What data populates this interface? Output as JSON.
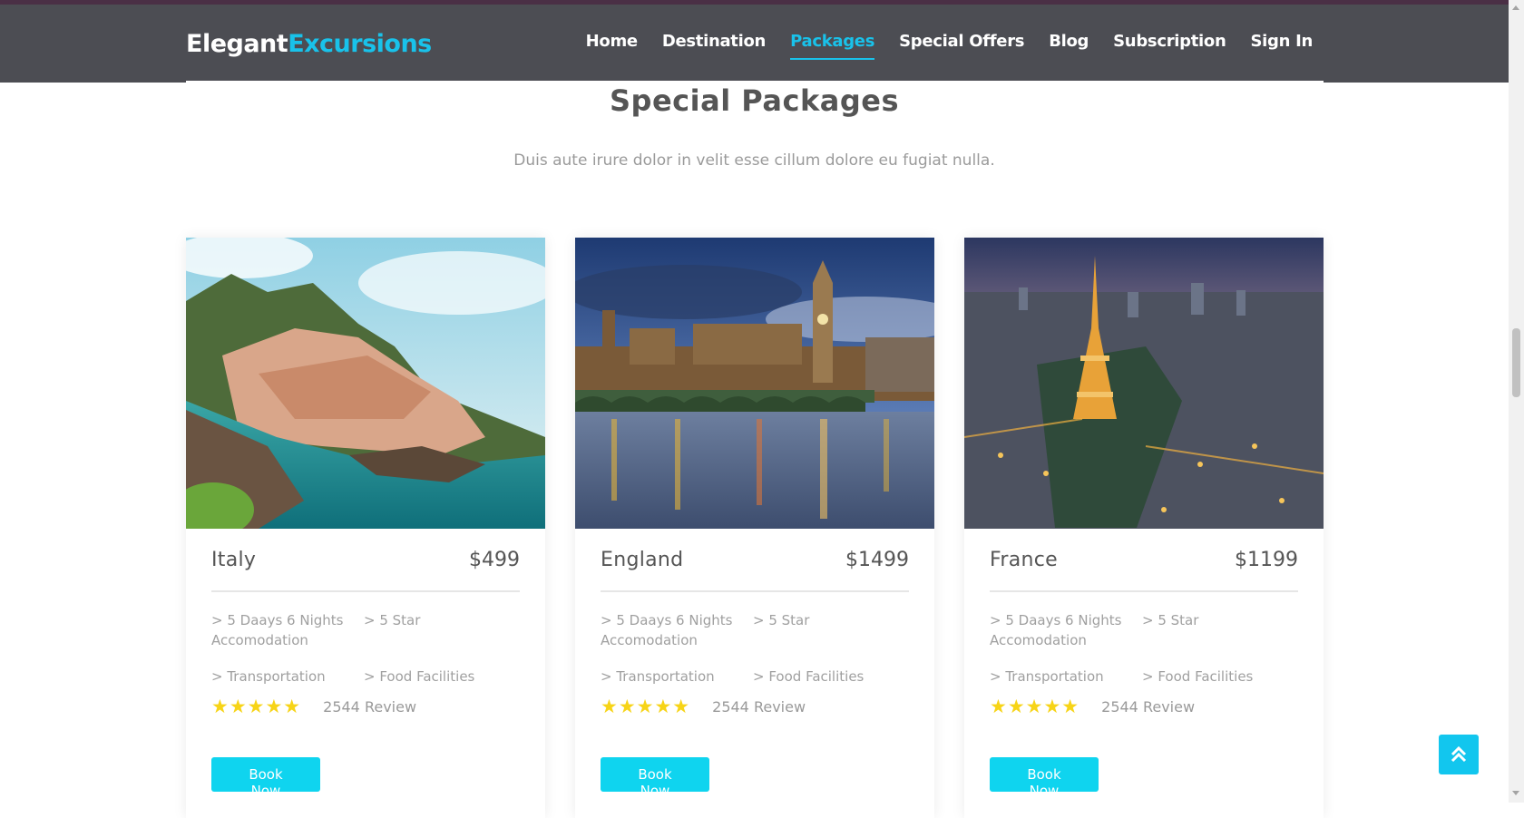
{
  "brand": {
    "part1": "Elegant",
    "part2": "Excursions"
  },
  "nav": {
    "items": [
      {
        "label": "Home"
      },
      {
        "label": "Destination"
      },
      {
        "label": "Packages"
      },
      {
        "label": "Special Offers"
      },
      {
        "label": "Blog"
      },
      {
        "label": "Subscription"
      },
      {
        "label": "Sign In"
      }
    ],
    "active": "Packages"
  },
  "section": {
    "title": "Special Packages",
    "subtitle": "Duis aute irure dolor in velit esse cillum dolore eu fugiat nulla."
  },
  "packages": [
    {
      "name": "Italy",
      "price": "$499",
      "features": [
        "> 5 Daays 6 Nights Accomodation",
        "> 5 Star",
        "> Transportation",
        "> Food Facilities"
      ],
      "stars": "★★★★★",
      "rating": 5,
      "reviews": "2544 Review",
      "button": "Book Now"
    },
    {
      "name": "England",
      "price": "$1499",
      "features": [
        "> 5 Daays 6 Nights Accomodation",
        "> 5 Star",
        "> Transportation",
        "> Food Facilities"
      ],
      "stars": "★★★★★",
      "rating": 5,
      "reviews": "2544 Review",
      "button": "Book Now"
    },
    {
      "name": "France",
      "price": "$1199",
      "features": [
        "> 5 Daays 6 Nights Accomodation",
        "> 5 Star",
        "> Transportation",
        "> Food Facilities"
      ],
      "stars": "★★★★★",
      "rating": 5,
      "reviews": "2544 Review",
      "button": "Book Now"
    }
  ],
  "colors": {
    "accent": "#19c2ea",
    "navbar": "#4c4d53",
    "button": "#0fd4ef",
    "star": "#f7d417"
  },
  "icons": {
    "scroll_top": "double-chevron-up-icon"
  }
}
